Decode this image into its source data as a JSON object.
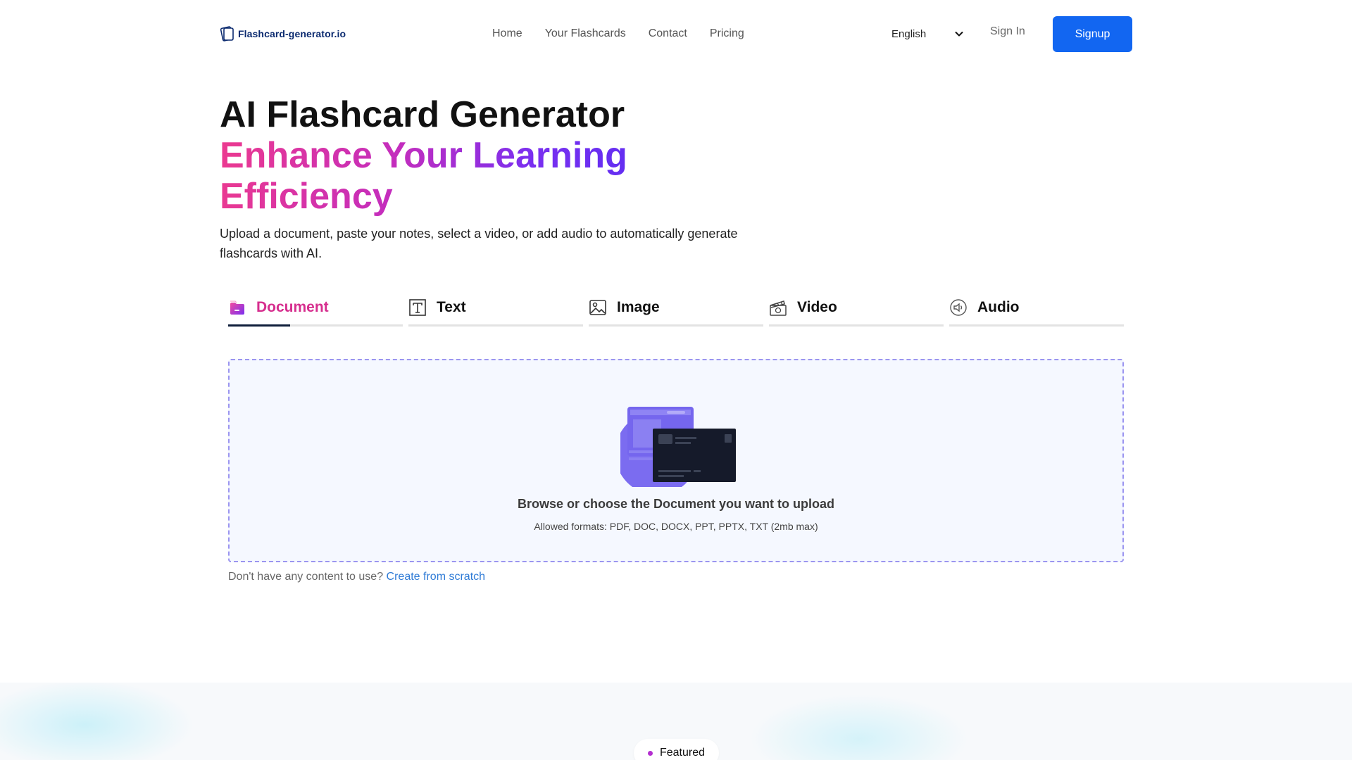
{
  "brand": {
    "name": "Flashcard-generator.io",
    "icon": "flashcard-logo-icon"
  },
  "nav": {
    "items": [
      {
        "label": "Home"
      },
      {
        "label": "Your Flashcards"
      },
      {
        "label": "Contact"
      },
      {
        "label": "Pricing"
      }
    ]
  },
  "header": {
    "language": "English",
    "language_icon": "chevron-down-icon",
    "signin_label": "Sign In",
    "signup_label": "Signup"
  },
  "hero": {
    "title": "AI Flashcard Generator",
    "subtitle": "Enhance Your Learning Efficiency",
    "description": "Upload a document, paste your notes, select a video, or add audio to automatically generate flashcards with AI."
  },
  "tabs": [
    {
      "label": "Document",
      "icon": "folder-icon",
      "active": true
    },
    {
      "label": "Text",
      "icon": "text-icon",
      "active": false
    },
    {
      "label": "Image",
      "icon": "image-icon",
      "active": false
    },
    {
      "label": "Video",
      "icon": "clapperboard-icon",
      "active": false
    },
    {
      "label": "Audio",
      "icon": "speaker-icon",
      "active": false
    }
  ],
  "upload": {
    "title": "Browse or choose the Document you want to upload",
    "formats": "Allowed formats: PDF, DOC, DOCX, PPT, PPTX, TXT (2mb max)"
  },
  "scratch": {
    "prompt": "Don't have any content to use?",
    "link_label": "Create from scratch"
  },
  "featured": {
    "label": "Featured"
  },
  "colors": {
    "primary": "#1266f1",
    "active_tab": "#d62e8e",
    "gradient_start": "#ec3a8f",
    "gradient_end": "#5b2ef2",
    "link": "#2f7bd6",
    "upload_border": "#9b95f0"
  }
}
